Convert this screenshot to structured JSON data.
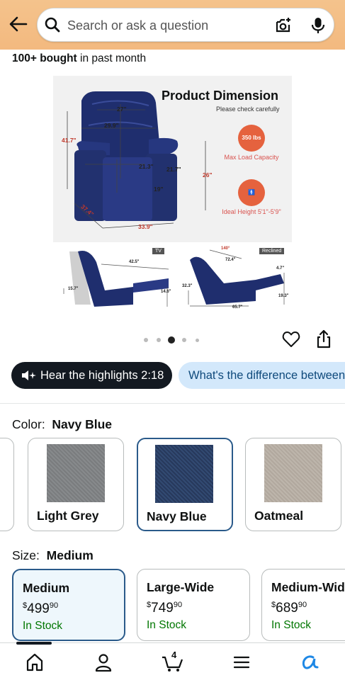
{
  "header": {
    "search_placeholder": "Search or ask a question"
  },
  "bought": {
    "bold": "100+ bought",
    "rest": " in past month"
  },
  "product_image": {
    "title": "Product Dimension",
    "subtitle": "Please check carefully",
    "dims": [
      "27\"",
      "29.9\"",
      "41.7\"",
      "21.3\"",
      "21.7\"",
      "26\"",
      "19\"",
      "37.4\"",
      "33.9\""
    ],
    "features": [
      {
        "badge": "350 lbs",
        "label": "Max Load Capacity"
      },
      {
        "label": "Ideal Height 5'1\"-5'9\""
      }
    ],
    "thumb_tags": [
      "TV",
      "Reclined"
    ],
    "thumb1_dims": [
      "42.5\"",
      "15.7\"",
      "14.6\""
    ],
    "thumb2_dims": [
      "140°",
      "72.4\"",
      "4.7\"",
      "32.3\"",
      "19.3\"",
      "65.7\""
    ]
  },
  "carousel": {
    "count": 5,
    "active_index": 2
  },
  "chips": {
    "hear": "Hear the highlights 2:18",
    "ask": "What's the difference between"
  },
  "color": {
    "label": "Color:",
    "value": "Navy Blue",
    "options": [
      {
        "name": "Light Grey",
        "swatch": "#7f8183"
      },
      {
        "name": "Navy Blue",
        "swatch": "#2b3f63"
      },
      {
        "name": "Oatmeal",
        "swatch": "#b5aca2"
      }
    ]
  },
  "size": {
    "label": "Size:",
    "value": "Medium",
    "options": [
      {
        "name": "Medium",
        "dollar": "$",
        "whole": "499",
        "cents": "90",
        "stock": "In Stock"
      },
      {
        "name": "Large-Wide",
        "dollar": "$",
        "whole": "749",
        "cents": "90",
        "stock": "In Stock"
      },
      {
        "name": "Medium-Wide",
        "dollar": "$",
        "whole": "689",
        "cents": "90",
        "stock": "In Stock"
      }
    ]
  },
  "nav": {
    "cart_count": "4"
  },
  "colors": {
    "accent": "#2a5a8a",
    "header": "#f3bd85",
    "in_stock": "#007600",
    "dark_chip": "#131921",
    "light_chip": "#d3e8fb"
  }
}
